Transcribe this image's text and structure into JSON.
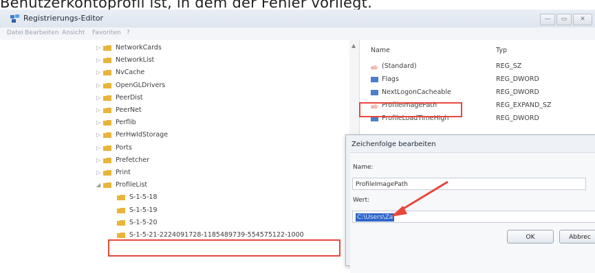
{
  "caption": "Benutzerkontoprofil ist, in dem der Fehler vorliegt.",
  "window": {
    "title": "Registrierungs-Editor",
    "minimize_icon": "minimize-icon",
    "maximize_icon": "maximize-icon",
    "close_icon": "close-icon"
  },
  "menu": [
    "Datei",
    "Bearbeiten",
    "Ansicht",
    "Favoriten",
    "?"
  ],
  "tree": {
    "items": [
      {
        "label": "NetworkCards"
      },
      {
        "label": "NetworkList"
      },
      {
        "label": "NvCache"
      },
      {
        "label": "OpenGLDrivers"
      },
      {
        "label": "PeerDist"
      },
      {
        "label": "PeerNet"
      },
      {
        "label": "Perflib"
      },
      {
        "label": "PerHwIdStorage"
      },
      {
        "label": "Ports"
      },
      {
        "label": "Prefetcher"
      },
      {
        "label": "Print"
      },
      {
        "label": "ProfileList"
      },
      {
        "label": "S-1-5-18"
      },
      {
        "label": "S-1-5-19"
      },
      {
        "label": "S-1-5-20"
      },
      {
        "label": "S-1-5-21-2224091728-1185489739-554575122-1000"
      }
    ]
  },
  "list": {
    "headers": {
      "name": "Name",
      "type": "Typ"
    },
    "rows": [
      {
        "name": "(Standard)",
        "type": "REG_SZ",
        "icon": "string-value-icon"
      },
      {
        "name": "Flags",
        "type": "REG_DWORD",
        "icon": "binary-value-icon"
      },
      {
        "name": "NextLogonCacheable",
        "type": "REG_DWORD",
        "icon": "binary-value-icon"
      },
      {
        "name": "ProfileImagePath",
        "type": "REG_EXPAND_SZ",
        "icon": "string-value-icon"
      },
      {
        "name": "ProfileLoadTimeHigh",
        "type": "REG_DWORD",
        "icon": "binary-value-icon"
      }
    ]
  },
  "dialog": {
    "title": "Zeichenfolge bearbeiten",
    "name_label": "Name:",
    "name_value": "ProfileImagePath",
    "value_label": "Wert:",
    "value_value": "C:\\Users\\Za",
    "ok_label": "OK",
    "cancel_label": "Abbrec"
  },
  "colors": {
    "highlight": "#e7473c",
    "selection": "#2e66c9",
    "folder": "#e8b53a"
  }
}
